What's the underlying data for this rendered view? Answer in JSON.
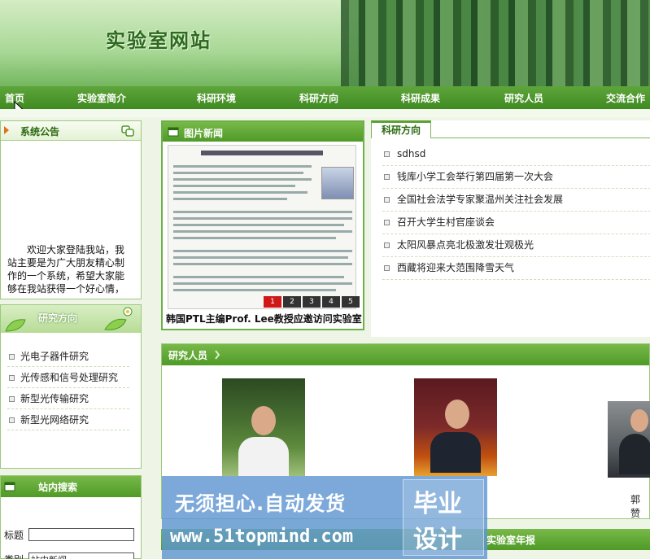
{
  "banner": {
    "site_title": "实验室网站"
  },
  "nav": {
    "items": [
      "首页",
      "实验室简介",
      "科研环境",
      "科研方向",
      "科研成果",
      "研究人员",
      "交流合作"
    ]
  },
  "notice": {
    "title": "系统公告",
    "text": "欢迎大家登陆我站，我站主要是为广大朋友精心制作的一个系统，希望大家能够在我站获得一个好心情，"
  },
  "research_sidebar": {
    "title": "研究方向",
    "items": [
      "光电子器件研究",
      "光传感和信号处理研究",
      "新型光传输研究",
      "新型光网络研究"
    ]
  },
  "photo_news": {
    "title": "图片新闻",
    "caption": "韩国PTL主编Prof. Lee教授应邀访问实验室",
    "pager": [
      "1",
      "2",
      "3",
      "4",
      "5"
    ]
  },
  "research_tab": {
    "title": "科研方向",
    "items": [
      "sdhsd",
      "钱库小学工会举行第四届第一次大会",
      "全国社会法学专家聚温州关注社会发展",
      "召开大学生村官座谈会",
      "太阳风暴点亮北极激发壮观极光",
      "西藏将迎来大范围降雪天气"
    ]
  },
  "researchers": {
    "title": "研究人员",
    "partial_name": "郭赞"
  },
  "site_search": {
    "title": "站内搜索",
    "title_label": "标题",
    "category_label": "类别",
    "category_value": "站内新闻"
  },
  "annual_report": {
    "title": "实验室年报"
  },
  "watermark": {
    "line1": "无须担心.自动发货",
    "line2": "www.51topmind.com",
    "badge1": "毕业",
    "badge2": "设计"
  },
  "colors": {
    "nav_green": "#4f9a26",
    "title_green": "#2a6a10",
    "pager_active": "#d01818"
  }
}
